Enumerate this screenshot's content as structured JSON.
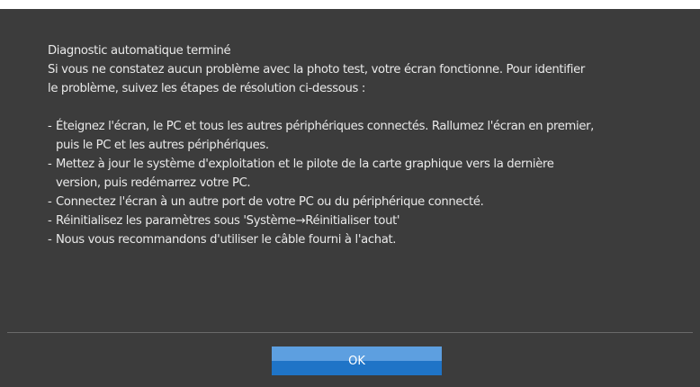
{
  "dialog": {
    "title": "Diagnostic automatique terminé",
    "intro_line1": "Si vous ne constatez aucun problème avec la photo test, votre écran fonctionne. Pour identifier",
    "intro_line2": "le problème, suivez les étapes de résolution ci-dessous :",
    "steps": [
      {
        "line1": "Éteignez l'écran, le PC et tous les autres périphériques connectés. Rallumez l'écran en premier,",
        "line2": "puis le PC et les autres périphériques."
      },
      {
        "line1": "Mettez à jour le système d'exploitation et le pilote de la carte graphique vers la dernière",
        "line2": "version, puis redémarrez votre PC."
      },
      {
        "line1": "Connectez l'écran à un autre port de votre PC ou du périphérique connecté."
      },
      {
        "line1": "Réinitialisez les paramètres sous 'Système→Réinitialiser tout'"
      },
      {
        "line1": "Nous vous recommandons d'utiliser le câble fourni à l'achat."
      }
    ],
    "bullet": "-",
    "ok_label": "OK"
  },
  "colors": {
    "background": "#3c3c3c",
    "text": "#e9e9e9",
    "divider": "#6a6a6a",
    "button_top": "#5d9fe0",
    "button_bottom": "#1f74c7"
  }
}
